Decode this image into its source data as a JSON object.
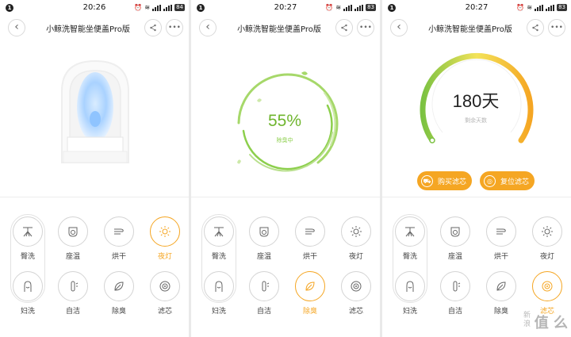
{
  "title": "小鲸洗智能坐便盖Pro版",
  "screens": [
    {
      "time": "20:26",
      "battery": "84"
    },
    {
      "time": "20:27",
      "battery": "83"
    },
    {
      "time": "20:27",
      "battery": "83"
    }
  ],
  "notification_badge": "1",
  "deodorize": {
    "percent": "55%",
    "status": "除臭中"
  },
  "filter": {
    "days": "180天",
    "caption": "剩余天数",
    "buy_label": "购买滤芯",
    "reset_label": "复位滤芯"
  },
  "controls": {
    "hip_wash": "臀洗",
    "seat_temp": "座温",
    "dry": "烘干",
    "night_light": "夜灯",
    "female_wash": "妇洗",
    "self_clean": "自洁",
    "deodorize": "除臭",
    "filter": "滤芯"
  },
  "watermark": "值 么",
  "watermark_small": "新 浪",
  "colors": {
    "accent": "#f5a623",
    "green": "#7cc242",
    "gauge_yellow": "#f5c518"
  },
  "icons": [
    "back-icon",
    "share-icon",
    "more-icon",
    "spray-icon",
    "seat-icon",
    "fan-icon",
    "sun-icon",
    "female-icon",
    "wand-icon",
    "leaf-icon",
    "filter-icon",
    "cart-icon",
    "reset-icon"
  ]
}
